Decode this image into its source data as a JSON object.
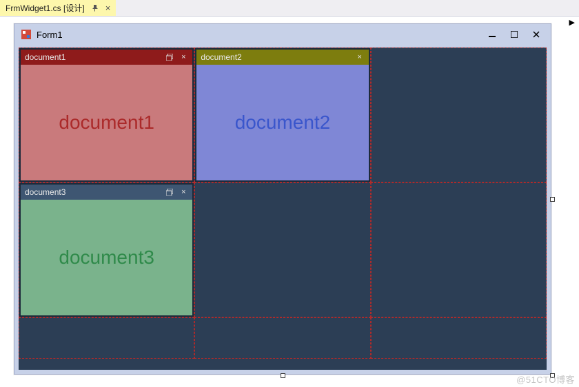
{
  "ide_tab": {
    "label": "FrmWidget1.cs [设计]"
  },
  "form_window": {
    "title": "Form1"
  },
  "panels": {
    "doc1": {
      "header": "document1",
      "body": "document1"
    },
    "doc2": {
      "header": "document2",
      "body": "document2"
    },
    "doc3": {
      "header": "document3",
      "body": "document3"
    }
  },
  "watermark": "@51CTO博客"
}
